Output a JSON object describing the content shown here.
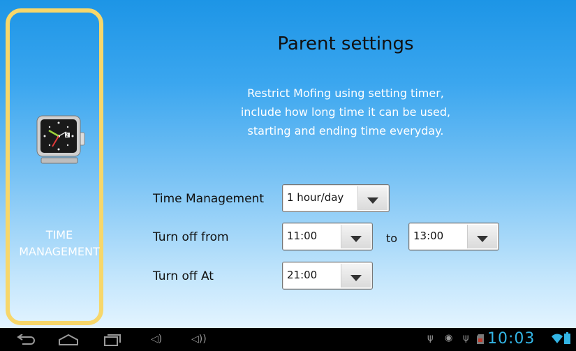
{
  "page": {
    "title": "Parent settings",
    "description_lines": [
      "Restrict Mofing using setting timer,",
      "include how long time it can be used,",
      "starting and ending time everyday."
    ]
  },
  "sidebar": {
    "item_label_line1": "TIME",
    "item_label_line2": "MANAGEMENT",
    "icon": "clock-icon",
    "highlight_color": "#f7d76a"
  },
  "form": {
    "time_management_label": "Time Management",
    "time_management_value": "1 hour/day",
    "turn_off_from_label": "Turn off from",
    "turn_off_from_value": "11:00",
    "to_label": "to",
    "turn_off_to_value": "13:00",
    "turn_off_at_label": "Turn off At",
    "turn_off_at_value": "21:00"
  },
  "navbar": {
    "icons": [
      "back-icon",
      "home-icon",
      "recent-apps-icon",
      "volume-down-icon",
      "volume-up-icon"
    ],
    "status_icons": [
      "usb-icon",
      "android-debug-icon",
      "usb-icon",
      "sd-card-icon",
      "wifi-icon",
      "battery-icon"
    ],
    "clock": "10:03",
    "clock_color": "#33b5e5"
  }
}
